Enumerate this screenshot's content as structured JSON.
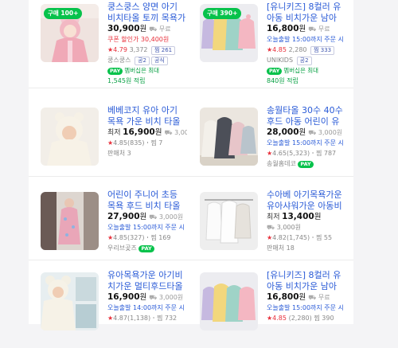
{
  "products": [
    {
      "tag": "구매 100+",
      "title": "쿵스쿵스 양면 아기 비치타올 토끼 목욕가운",
      "price": "30,900",
      "won": "원",
      "shipping": "무료",
      "coupon": "쿠폰 할인가 30,400원",
      "rating": "4.79",
      "reviews": "3,372",
      "zzim": "찜 261",
      "store": "쿵스쿵스",
      "store_badges": [
        "공2",
        "공식"
      ],
      "npay": "PAY",
      "member": "멤버십은 최대",
      "points": "1,545원 적립"
    },
    {
      "tag": "구매 390+",
      "title": "[유니키즈] 8컬러 유아동 비치가운 남아 여아",
      "price": "16,800",
      "won": "원",
      "shipping": "무료",
      "delivery": "오늘출발 15:00까지 주문 시",
      "rating": "4.85",
      "reviews": "2,280",
      "zzim": "찜 333",
      "store": "UNIKIDS",
      "store_badges": [
        "공2"
      ],
      "npay": "PAY",
      "member": "멤버십은 최대",
      "points": "840원 적립"
    },
    {
      "title": "베베코지 유아 아기 목욕 가운 비치 타올 곰",
      "prefix": "최저",
      "price": "16,900",
      "won": "원",
      "shipping": "3,000원",
      "rating": "4.85",
      "reviews": "(835)",
      "zzim": "찜 7",
      "sellers": "판매처 3"
    },
    {
      "title": "송월타올 30수 40수 후드 아동 어린이 유아",
      "price": "28,000",
      "won": "원",
      "shipping": "3,000원",
      "delivery": "오늘출발 15:00까지 주문 시",
      "rating": "4.65",
      "reviews": "(5,323)",
      "zzim": "찜 787",
      "store": "송월홈데코",
      "npay": "PAY"
    },
    {
      "title": "어린이 주니어 초등 목욕 후드 비치 타올 가운",
      "price": "27,900",
      "won": "원",
      "shipping": "3,000원",
      "delivery": "오늘출발 15:00까지 주문 시",
      "rating": "4.85",
      "reviews": "(327)",
      "zzim": "찜 169",
      "store": "우리브곶즈",
      "npay": "PAY"
    },
    {
      "title": "수아베 아기목욕가운 유아샤워가운 아동비치",
      "prefix": "최저",
      "price": "13,400",
      "won": "원",
      "shipping": "3,000원",
      "rating": "4.82",
      "reviews": "(1,745)",
      "zzim": "찜 55",
      "sellers": "판매처 18"
    },
    {
      "title": "유아목욕가운 아기비치가운 멀티후드타올",
      "price": "16,900",
      "won": "원",
      "shipping": "3,000원",
      "delivery": "오늘출발 14:00까지 주문 시",
      "rating": "4.87",
      "reviews": "(1,138)",
      "zzim": "찜 732"
    },
    {
      "title": "[유니키즈] 8컬러 유아동 비치가운 남아 여아",
      "price": "16,800",
      "won": "원",
      "shipping": "무료",
      "delivery": "오늘출발 15:00까지 주문 시",
      "rating": "4.85",
      "reviews": "(2,280)",
      "zzim": "찜 390"
    }
  ],
  "symbols": {
    "star": "★",
    "truck": "⛟",
    "circle": "ⓜ"
  },
  "colors": {
    "link": "#2a5bd7",
    "accent": "#e8303b",
    "npay": "#07c24b"
  }
}
